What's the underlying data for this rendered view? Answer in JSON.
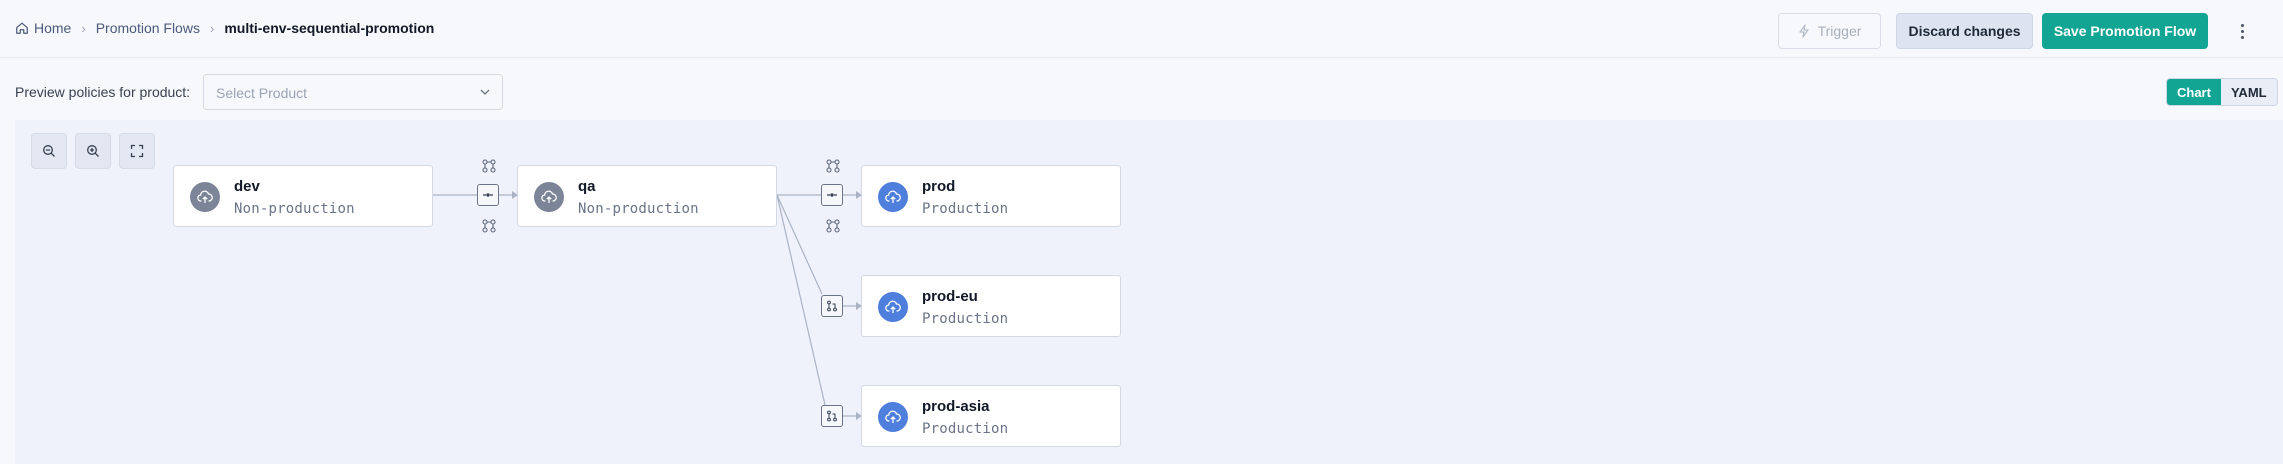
{
  "breadcrumb": {
    "home": "Home",
    "section": "Promotion Flows",
    "current": "multi-env-sequential-promotion"
  },
  "toolbar": {
    "trigger_label": "Trigger",
    "discard_label": "Discard changes",
    "save_label": "Save Promotion Flow"
  },
  "filter": {
    "label": "Preview policies for product:",
    "placeholder": "Select Product"
  },
  "view_toggle": {
    "chart_label": "Chart",
    "yaml_label": "YAML",
    "selected": "Chart"
  },
  "colors": {
    "accent": "#12a594",
    "production": "#4f7fdc",
    "non_production": "#7b8597"
  },
  "environments": [
    {
      "name": "dev",
      "type": "Non-production"
    },
    {
      "name": "qa",
      "type": "Non-production"
    },
    {
      "name": "prod",
      "type": "Production"
    },
    {
      "name": "prod-eu",
      "type": "Production"
    },
    {
      "name": "prod-asia",
      "type": "Production"
    }
  ]
}
